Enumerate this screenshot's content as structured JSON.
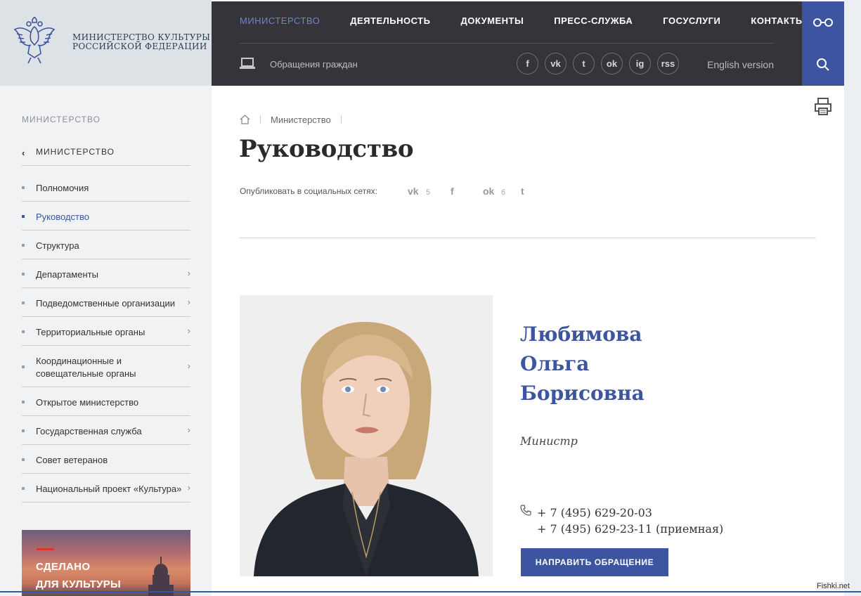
{
  "header": {
    "logo_line1": "МИНИСТЕРСТВО КУЛЬТУРЫ",
    "logo_line2": "РОССИЙСКОЙ ФЕДЕРАЦИИ",
    "nav": [
      {
        "label": "МИНИСТЕРСТВО",
        "active": true
      },
      {
        "label": "ДЕЯТЕЛЬНОСТЬ",
        "active": false
      },
      {
        "label": "ДОКУМЕНТЫ",
        "active": false
      },
      {
        "label": "ПРЕСС-СЛУЖБА",
        "active": false
      },
      {
        "label": "ГОСУСЛУГИ",
        "active": false
      },
      {
        "label": "КОНТАКТЫ",
        "active": false
      }
    ],
    "appeals_label": "Обращения граждан",
    "social": [
      {
        "icon": "facebook-icon",
        "glyph": "f"
      },
      {
        "icon": "vk-icon",
        "glyph": "vk"
      },
      {
        "icon": "twitter-icon",
        "glyph": "t"
      },
      {
        "icon": "odnoklassniki-icon",
        "glyph": "ok"
      },
      {
        "icon": "instagram-icon",
        "glyph": "ig"
      },
      {
        "icon": "rss-icon",
        "glyph": "rss"
      }
    ],
    "english_label": "English version",
    "accent_color": "#3d55a0"
  },
  "sidebar": {
    "heading": "МИНИСТЕРСТВО",
    "back_label": "МИНИСТЕРСТВО",
    "items": [
      {
        "label": "Полномочия",
        "active": false,
        "arrow": false
      },
      {
        "label": "Руководство",
        "active": true,
        "arrow": false
      },
      {
        "label": "Структура",
        "active": false,
        "arrow": false
      },
      {
        "label": "Департаменты",
        "active": false,
        "arrow": true
      },
      {
        "label": "Подведомственные организации",
        "active": false,
        "arrow": true
      },
      {
        "label": "Территориальные органы",
        "active": false,
        "arrow": true
      },
      {
        "label": "Координационные и совещательные органы",
        "active": false,
        "arrow": true
      },
      {
        "label": "Открытое министерство",
        "active": false,
        "arrow": false
      },
      {
        "label": "Государственная служба",
        "active": false,
        "arrow": true
      },
      {
        "label": "Совет ветеранов",
        "active": false,
        "arrow": false
      },
      {
        "label": "Национальный проект «Культура»",
        "active": false,
        "arrow": true
      }
    ],
    "promo_line1": "СДЕЛАНО",
    "promo_line2": "ДЛЯ КУЛЬТУРЫ"
  },
  "main": {
    "breadcrumb": "Министерство",
    "title": "Руководство",
    "share_label": "Опубликовать в социальных сетях:",
    "share": {
      "vk_glyph": "vk",
      "vk_count": "5",
      "fb_glyph": "f",
      "ok_glyph": "ok",
      "ok_count": "6",
      "tw_glyph": "t"
    },
    "person": {
      "name_line1": "Любимова",
      "name_line2": "Ольга",
      "name_line3": "Борисовна",
      "role": "Министр",
      "phone1": "+ 7 (495) 629-20-03",
      "phone2": "+ 7 (495) 629-23-11 (приемная)",
      "button": "НАПРАВИТЬ ОБРАЩЕНИЕ"
    }
  },
  "watermark": "Fishki.net"
}
